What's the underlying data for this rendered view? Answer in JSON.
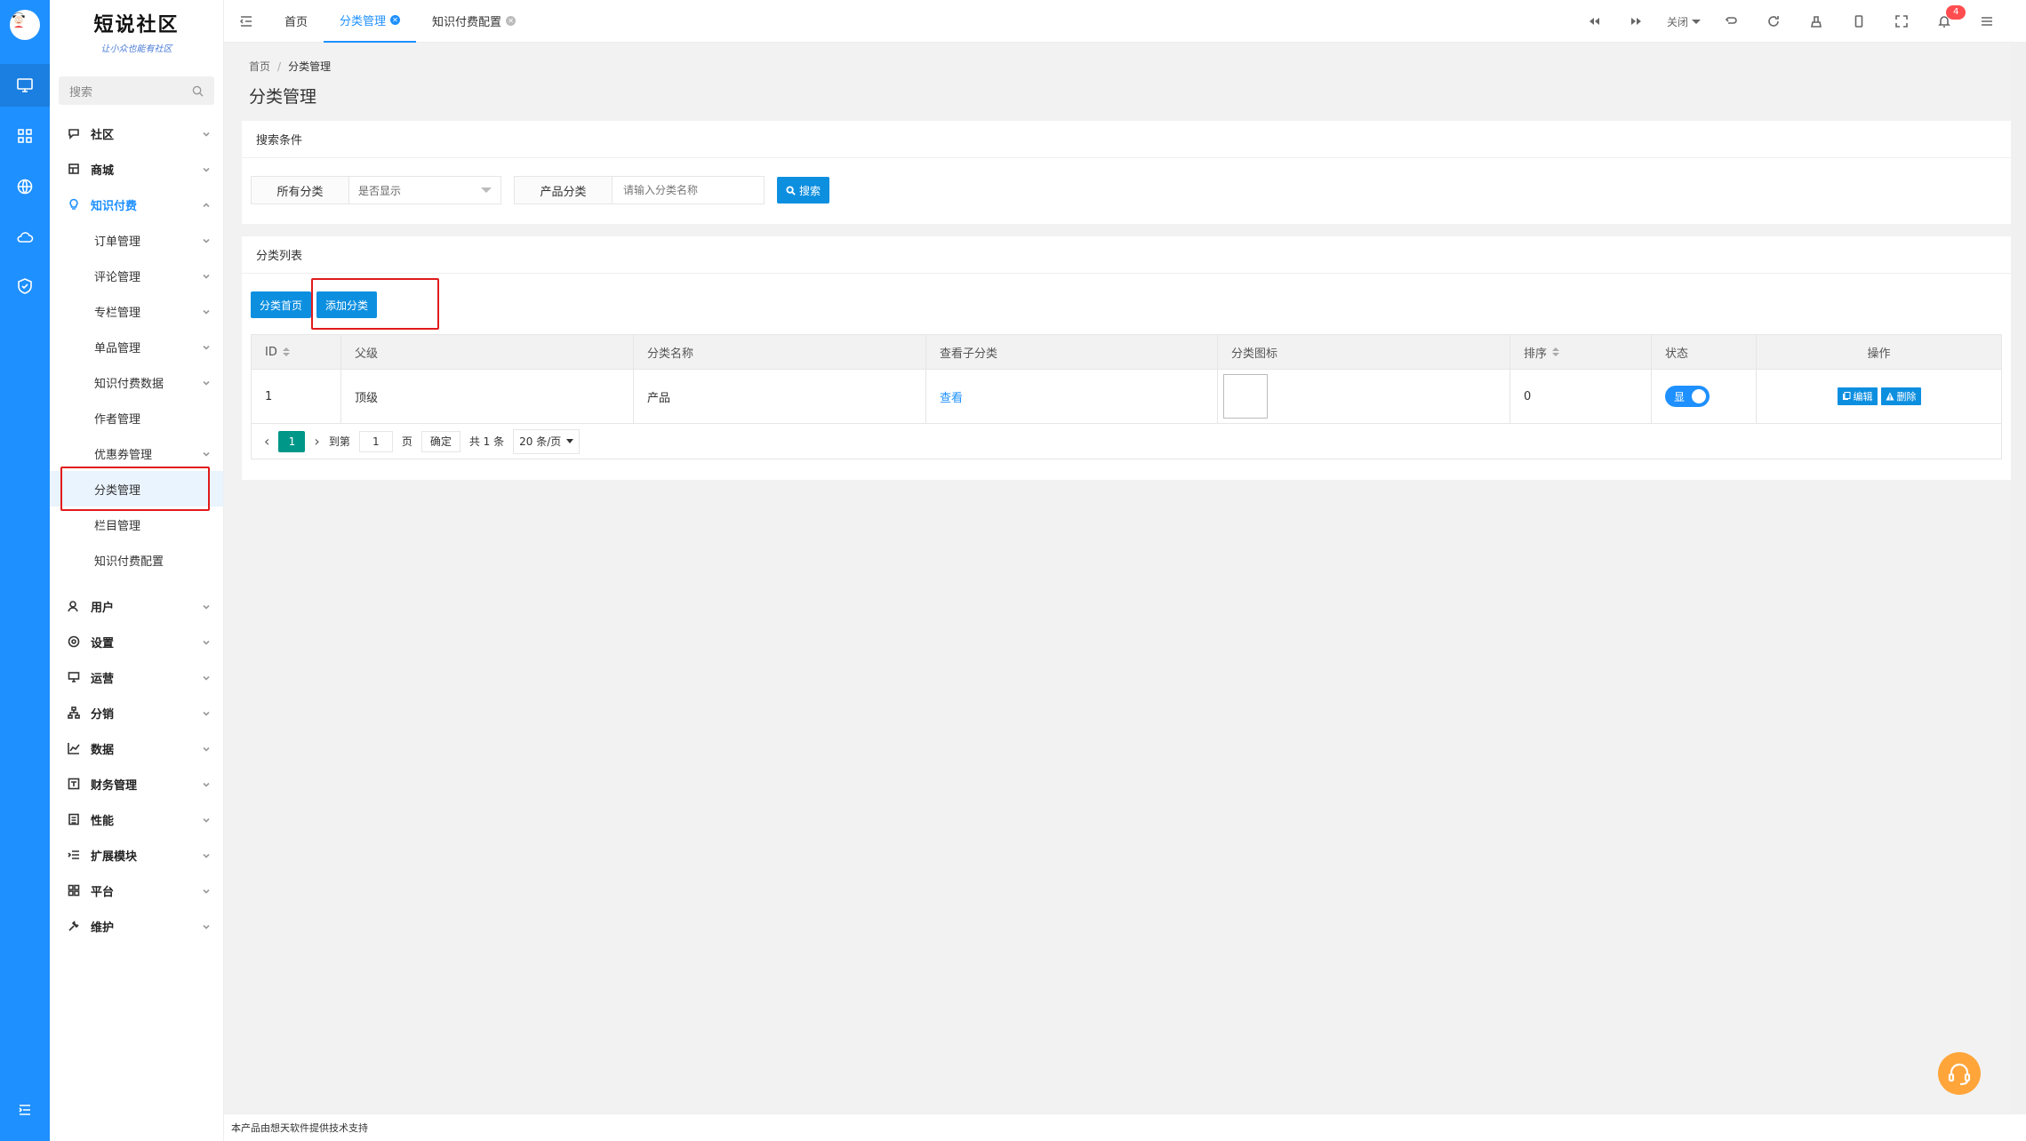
{
  "brand": {
    "title": "短说社区",
    "slogan": "让小众也能有社区"
  },
  "sidebar": {
    "search_placeholder": "搜索",
    "groups": [
      {
        "label": "社区",
        "icon": "chat-icon"
      },
      {
        "label": "商城",
        "icon": "store-icon"
      },
      {
        "label": "知识付费",
        "icon": "bulb-icon"
      }
    ],
    "sub_items": [
      {
        "label": "订单管理"
      },
      {
        "label": "评论管理"
      },
      {
        "label": "专栏管理"
      },
      {
        "label": "单品管理"
      },
      {
        "label": "知识付费数据"
      },
      {
        "label": "作者管理"
      },
      {
        "label": "优惠券管理"
      },
      {
        "label": "分类管理"
      },
      {
        "label": "栏目管理"
      },
      {
        "label": "知识付费配置"
      }
    ],
    "bottom_groups": [
      {
        "label": "用户",
        "icon": "user-icon"
      },
      {
        "label": "设置",
        "icon": "settings-icon"
      },
      {
        "label": "运营",
        "icon": "monitor-icon"
      },
      {
        "label": "分销",
        "icon": "hierarchy-icon"
      },
      {
        "label": "数据",
        "icon": "line-chart-icon"
      },
      {
        "label": "财务管理",
        "icon": "finance-icon"
      },
      {
        "label": "性能",
        "icon": "list-icon"
      },
      {
        "label": "扩展模块",
        "icon": "extend-icon"
      },
      {
        "label": "平台",
        "icon": "platform-icon"
      },
      {
        "label": "维护",
        "icon": "wrench-icon"
      }
    ]
  },
  "tabs": [
    {
      "label": "首页"
    },
    {
      "label": "分类管理"
    },
    {
      "label": "知识付费配置"
    }
  ],
  "tools": {
    "close_label": "关闭",
    "notification_count": "4"
  },
  "breadcrumb": {
    "home": "首页",
    "sep": "/",
    "current": "分类管理"
  },
  "page_title": "分类管理",
  "search_card": {
    "title": "搜索条件",
    "filter1_label": "所有分类",
    "filter1_value": "是否显示",
    "filter2_label": "产品分类",
    "filter2_placeholder": "请输入分类名称",
    "search_button": "搜索"
  },
  "list_card": {
    "title": "分类列表",
    "btn_home": "分类首页",
    "btn_add": "添加分类",
    "columns": [
      "ID",
      "父级",
      "分类名称",
      "查看子分类",
      "分类图标",
      "排序",
      "状态",
      "操作"
    ],
    "rows": [
      {
        "id": "1",
        "parent": "顶级",
        "name": "产品",
        "view": "查看",
        "sort": "0",
        "status": "显"
      }
    ],
    "actions": {
      "edit": "编辑",
      "delete": "删除"
    }
  },
  "pager": {
    "current": "1",
    "goto": "到第",
    "page_input": "1",
    "page_unit": "页",
    "confirm": "确定",
    "total": "共 1 条",
    "size": "20 条/页"
  },
  "footer": "本产品由想天软件提供技术支持"
}
